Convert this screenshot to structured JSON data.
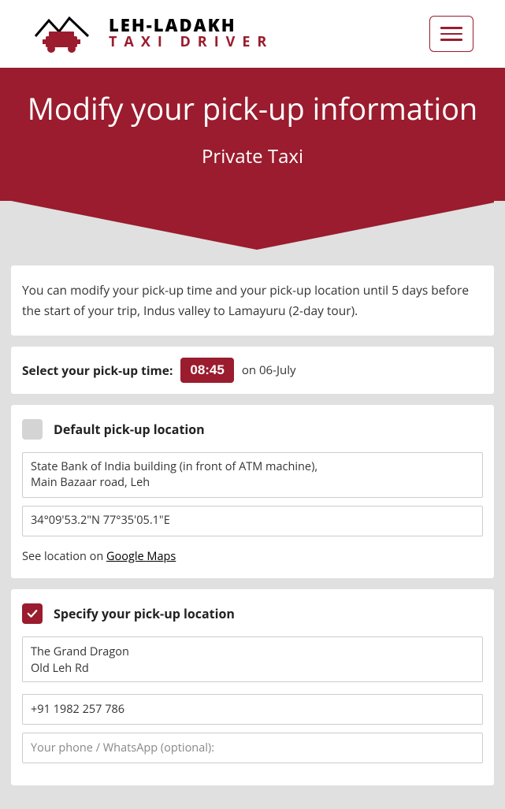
{
  "logo": {
    "line1": "LEH-LADAKH",
    "line2": "TAXI DRIVER"
  },
  "hero": {
    "title": "Modify your pick-up information",
    "subtitle": "Private Taxi"
  },
  "info_text": "You can modify your pick-up time and your pick-up location until 5 days before the start of your trip, Indus valley to Lamayuru (2-day tour).",
  "pickup_time": {
    "label": "Select your pick-up time:",
    "value": "08:45",
    "date_prefix": "on",
    "date": "06-July"
  },
  "default_location": {
    "label": "Default pick-up location",
    "address_line1": "State Bank of India building (in front of ATM machine),",
    "address_line2": "Main Bazaar road, Leh",
    "coordinates": "34°09'53.2\"N 77°35'05.1\"E",
    "maps_prefix": "See location on ",
    "maps_link_text": "Google Maps"
  },
  "custom_location": {
    "label": "Specify your pick-up location",
    "address_value": "The Grand Dragon\nOld Leh Rd",
    "phone_value": "+91 1982 257 786",
    "your_phone_placeholder": "Your phone / WhatsApp (optional):"
  }
}
